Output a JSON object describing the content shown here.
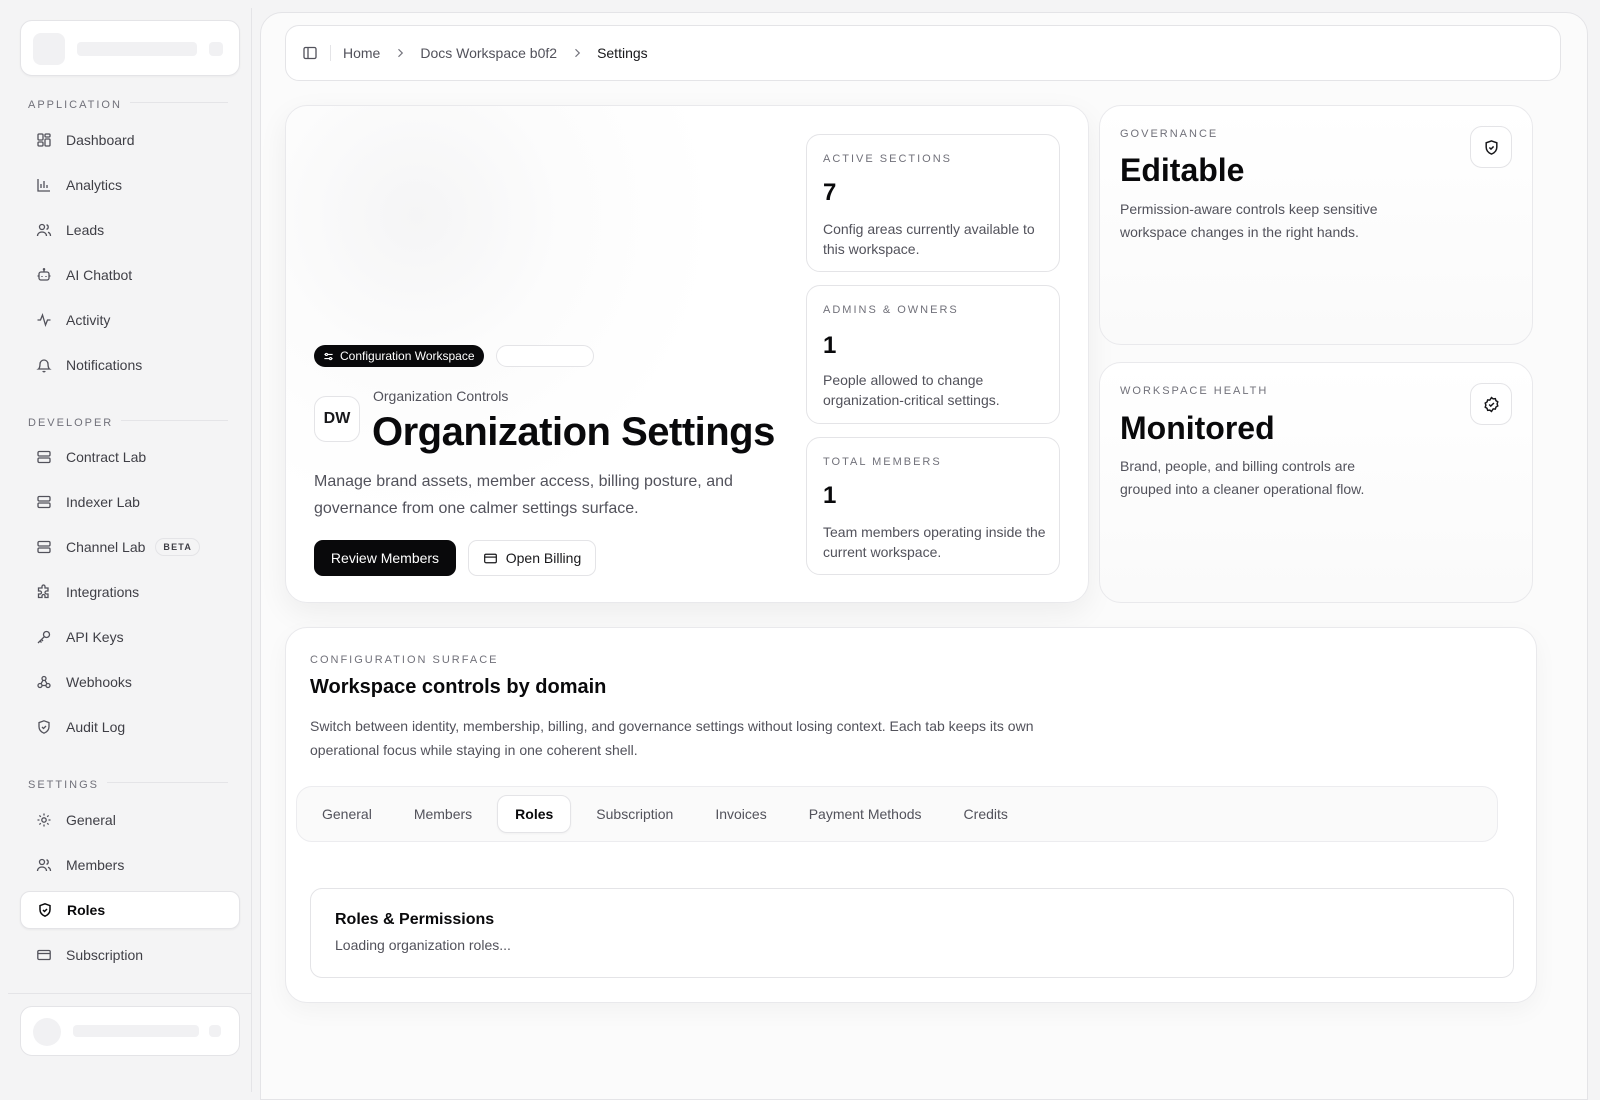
{
  "sidebar": {
    "sections": {
      "application": "APPLICATION",
      "developer": "DEVELOPER",
      "settings": "SETTINGS"
    },
    "application_items": [
      {
        "label": "Dashboard",
        "icon": "grid-icon"
      },
      {
        "label": "Analytics",
        "icon": "bar-chart-icon"
      },
      {
        "label": "Leads",
        "icon": "users-icon"
      },
      {
        "label": "AI Chatbot",
        "icon": "bot-icon"
      },
      {
        "label": "Activity",
        "icon": "activity-icon"
      },
      {
        "label": "Notifications",
        "icon": "bell-icon"
      }
    ],
    "developer_items": [
      {
        "label": "Contract Lab",
        "icon": "server-icon"
      },
      {
        "label": "Indexer Lab",
        "icon": "server-icon"
      },
      {
        "label": "Channel Lab",
        "icon": "server-icon",
        "badge": "BETA"
      },
      {
        "label": "Integrations",
        "icon": "puzzle-icon"
      },
      {
        "label": "API Keys",
        "icon": "key-icon"
      },
      {
        "label": "Webhooks",
        "icon": "webhook-icon"
      },
      {
        "label": "Audit Log",
        "icon": "shield-icon"
      }
    ],
    "settings_items": [
      {
        "label": "General",
        "icon": "gear-icon"
      },
      {
        "label": "Members",
        "icon": "users-icon"
      },
      {
        "label": "Roles",
        "icon": "shield-check-icon",
        "active": true
      },
      {
        "label": "Subscription",
        "icon": "credit-card-icon"
      }
    ]
  },
  "breadcrumb": {
    "items": [
      "Home",
      "Docs Workspace b0f2",
      "Settings"
    ]
  },
  "hero": {
    "badge": "Configuration Workspace",
    "avatar": "DW",
    "eyebrow": "Organization Controls",
    "title": "Organization Settings",
    "description": "Manage brand assets, member access, billing posture, and governance from one calmer settings surface.",
    "primary_button": "Review Members",
    "secondary_button": "Open Billing"
  },
  "stats": [
    {
      "label": "ACTIVE SECTIONS",
      "value": "7",
      "description": "Config areas currently available to this workspace."
    },
    {
      "label": "ADMINS & OWNERS",
      "value": "1",
      "description": "People allowed to change organization-critical settings."
    },
    {
      "label": "TOTAL MEMBERS",
      "value": "1",
      "description": "Team members operating inside the current workspace."
    }
  ],
  "governance": {
    "label": "GOVERNANCE",
    "value": "Editable",
    "description": "Permission-aware controls keep sensitive workspace changes in the right hands."
  },
  "health": {
    "label": "WORKSPACE HEALTH",
    "value": "Monitored",
    "description": "Brand, people, and billing controls are grouped into a cleaner operational flow."
  },
  "config": {
    "label": "CONFIGURATION SURFACE",
    "title": "Workspace controls by domain",
    "description": "Switch between identity, membership, billing, and governance settings without losing context. Each tab keeps its own operational focus while staying in one coherent shell.",
    "tabs": [
      "General",
      "Members",
      "Roles",
      "Subscription",
      "Invoices",
      "Payment Methods",
      "Credits"
    ],
    "active_tab": "Roles"
  },
  "roles_panel": {
    "title": "Roles & Permissions",
    "status": "Loading organization roles..."
  }
}
